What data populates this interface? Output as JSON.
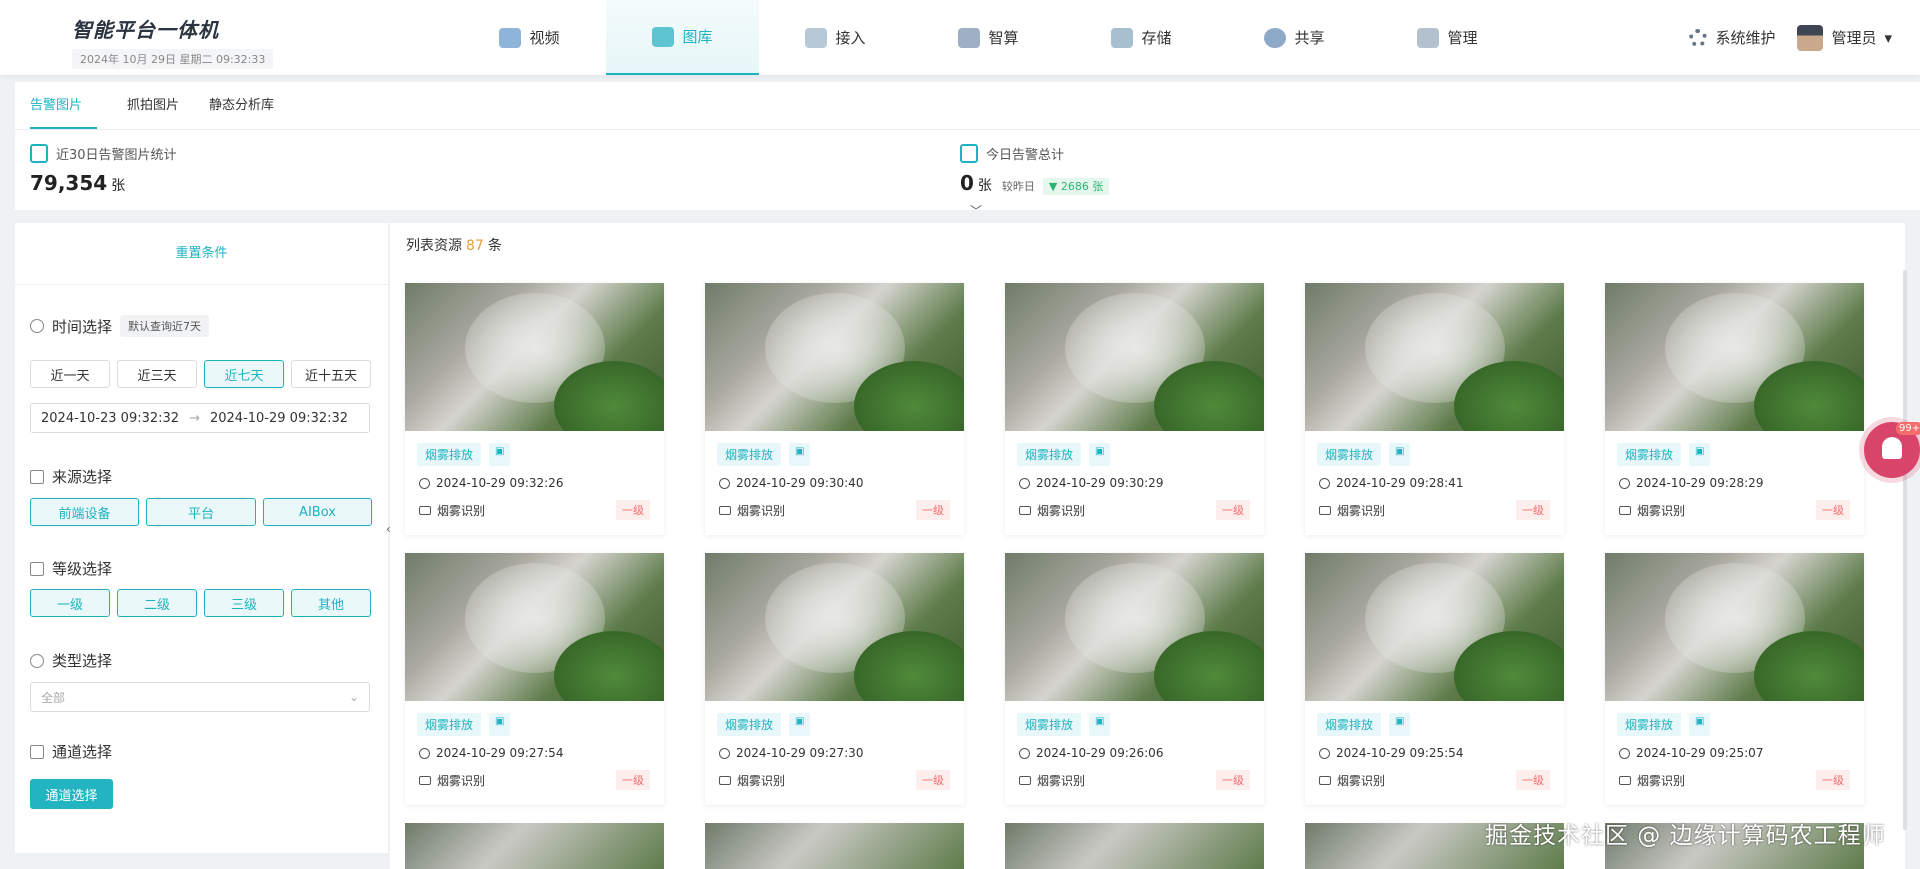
{
  "app": {
    "title": "智能平台一体机",
    "datetime": "2024年 10月 29日 星期二 09:32:33"
  },
  "nav": [
    {
      "label": "视频",
      "icon": "video-icon",
      "active": false
    },
    {
      "label": "图库",
      "icon": "gallery-icon",
      "active": true
    },
    {
      "label": "接入",
      "icon": "cloud-icon",
      "active": false
    },
    {
      "label": "智算",
      "icon": "compute-icon",
      "active": false
    },
    {
      "label": "存储",
      "icon": "storage-icon",
      "active": false
    },
    {
      "label": "共享",
      "icon": "share-icon",
      "active": false
    },
    {
      "label": "管理",
      "icon": "manage-icon",
      "active": false
    }
  ],
  "header": {
    "system_label": "系统维护",
    "user_label": "管理员"
  },
  "tabs": [
    "告警图片",
    "抓拍图片",
    "静态分析库"
  ],
  "stats": {
    "month_label": "近30日告警图片统计",
    "month_value": "79,354",
    "month_unit": "张",
    "today_label": "今日告警总计",
    "today_value": "0",
    "today_unit": "张",
    "compare_label": "较昨日",
    "compare_value": "▼ 2686 张"
  },
  "filters": {
    "reset": "重置条件",
    "time_title": "时间选择",
    "time_hint": "默认查询近7天",
    "time_buttons": [
      "近一天",
      "近三天",
      "近七天",
      "近十五天"
    ],
    "date_start": "2024-10-23 09:32:32",
    "date_end": "2024-10-29 09:32:32",
    "source_title": "来源选择",
    "source_buttons": [
      "前端设备",
      "平台",
      "AIBox"
    ],
    "level_title": "等级选择",
    "level_buttons": [
      "一级",
      "二级",
      "三级",
      "其他"
    ],
    "type_title": "类型选择",
    "type_placeholder": "全部",
    "channel_title": "通道选择",
    "channel_button": "通道选择"
  },
  "list": {
    "title": "列表资源",
    "count": "87",
    "unit": "条"
  },
  "cards": [
    {
      "tag": "烟雾排放",
      "time": "2024-10-29 09:32:26",
      "type": "烟雾识别",
      "level": "一级"
    },
    {
      "tag": "烟雾排放",
      "time": "2024-10-29 09:30:40",
      "type": "烟雾识别",
      "level": "一级"
    },
    {
      "tag": "烟雾排放",
      "time": "2024-10-29 09:30:29",
      "type": "烟雾识别",
      "level": "一级"
    },
    {
      "tag": "烟雾排放",
      "time": "2024-10-29 09:28:41",
      "type": "烟雾识别",
      "level": "一级"
    },
    {
      "tag": "烟雾排放",
      "time": "2024-10-29 09:28:29",
      "type": "烟雾识别",
      "level": "一级"
    },
    {
      "tag": "烟雾排放",
      "time": "2024-10-29 09:27:54",
      "type": "烟雾识别",
      "level": "一级"
    },
    {
      "tag": "烟雾排放",
      "time": "2024-10-29 09:27:30",
      "type": "烟雾识别",
      "level": "一级"
    },
    {
      "tag": "烟雾排放",
      "time": "2024-10-29 09:26:06",
      "type": "烟雾识别",
      "level": "一级"
    },
    {
      "tag": "烟雾排放",
      "time": "2024-10-29 09:25:54",
      "type": "烟雾识别",
      "level": "一级"
    },
    {
      "tag": "烟雾排放",
      "time": "2024-10-29 09:25:07",
      "type": "烟雾识别",
      "level": "一级"
    }
  ],
  "notification_badge": "99+",
  "watermark": "掘金技术社区 @ 边缘计算码农工程师",
  "colors": {
    "accent": "#1fb3c1",
    "level": "#f56c6c",
    "bell": "#d8446a"
  }
}
